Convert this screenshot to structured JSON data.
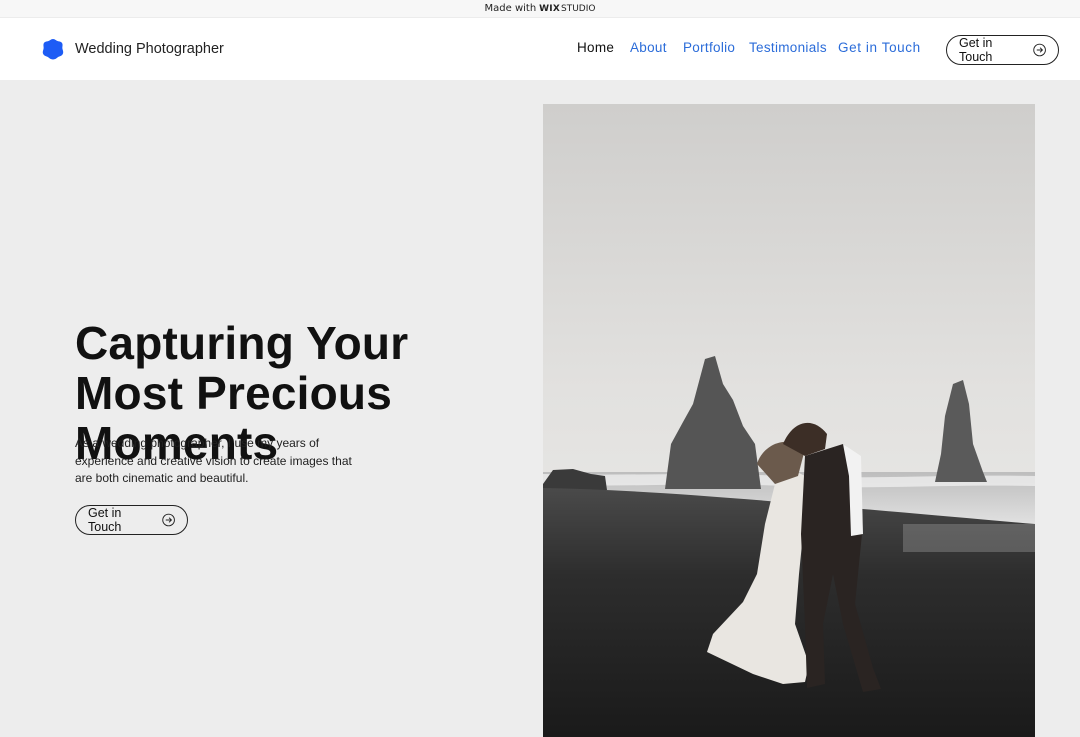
{
  "topbar": {
    "made_with": "Made with",
    "brand": "WIX",
    "brand_suffix": "STUDIO"
  },
  "header": {
    "site_title": "Wedding Photographer",
    "nav": [
      {
        "label": "Home",
        "active": true
      },
      {
        "label": "About"
      },
      {
        "label": "Portfolio"
      },
      {
        "label": "Testimonials"
      },
      {
        "label": "Get in Touch"
      }
    ],
    "cta_label": "Get in Touch"
  },
  "hero": {
    "title": "Capturing Your Most Precious Moments",
    "description": "As a wedding photographer, I use my years of experience and creative vision to create images that are both cinematic and beautiful.",
    "cta_label": "Get in Touch"
  },
  "colors": {
    "accent": "#2b6cd9",
    "logo": "#1d5cf5",
    "background": "#ededed"
  },
  "icons": {
    "logo": "blob-logo-icon",
    "arrow": "arrow-right-circle-icon"
  }
}
